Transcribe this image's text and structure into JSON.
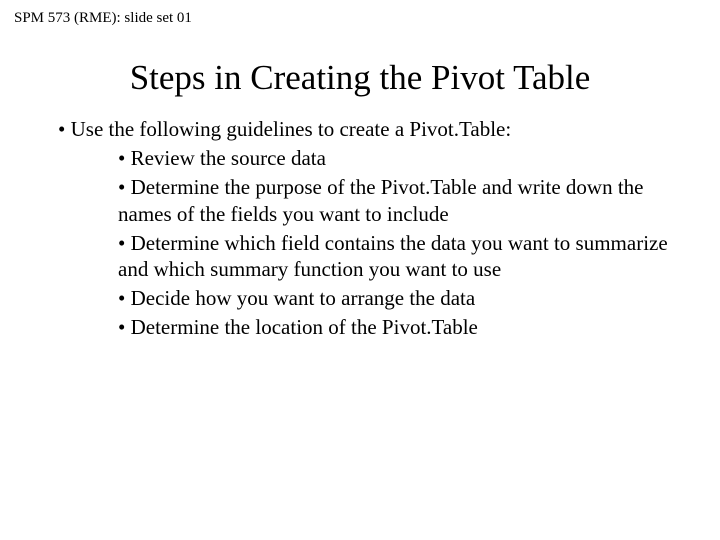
{
  "header": "SPM 573 (RME): slide set 01",
  "title": "Steps in Creating the Pivot Table",
  "lead": "• Use the following guidelines to create a Pivot.Table:",
  "subs": [
    "• Review the source data",
    "• Determine the purpose of the Pivot.Table and write down the names of the fields you want to include",
    "• Determine which field contains the data you want to summarize and which summary function you want to use",
    "• Decide how you want to arrange the data",
    "• Determine the location of the Pivot.Table"
  ]
}
